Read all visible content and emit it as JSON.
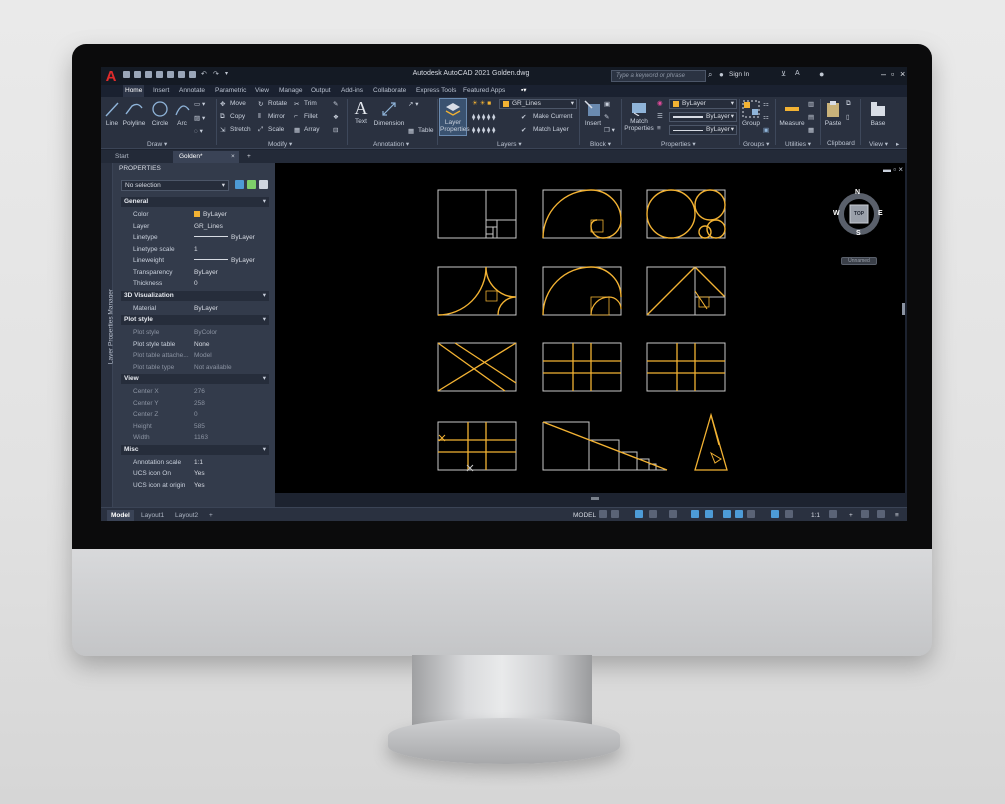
{
  "app": {
    "title": "Autodesk AutoCAD 2021   Golden.dwg",
    "logo": "A",
    "search_placeholder": "Type a keyword or phrase",
    "sign_in": "Sign In",
    "accent_color": "#f2b233"
  },
  "ribbon_tabs": [
    "Home",
    "Insert",
    "Annotate",
    "Parametric",
    "View",
    "Manage",
    "Output",
    "Add-ins",
    "Collaborate",
    "Express Tools",
    "Featured Apps"
  ],
  "ribbon": {
    "draw": {
      "line": "Line",
      "polyline": "Polyline",
      "circle": "Circle",
      "arc": "Arc",
      "panel": "Draw ▾"
    },
    "modify": {
      "move": "Move",
      "rotate": "Rotate",
      "trim": "Trim",
      "copy": "Copy",
      "mirror": "Mirror",
      "fillet": "Fillet",
      "stretch": "Stretch",
      "scale": "Scale",
      "array": "Array",
      "panel": "Modify ▾"
    },
    "annotation": {
      "text": "Text",
      "dimension": "Dimension",
      "table": "Table",
      "panel": "Annotation ▾"
    },
    "layers": {
      "layer_properties_1": "Layer",
      "layer_properties_2": "Properties",
      "layer_name": "GR_Lines",
      "make_current": "Make Current",
      "match_layer": "Match Layer",
      "panel": "Layers ▾"
    },
    "block": {
      "insert": "Insert",
      "panel": "Block ▾"
    },
    "properties": {
      "match_1": "Match",
      "match_2": "Properties",
      "bylayer_color": "ByLayer",
      "bylayer_lineweight": "ByLayer",
      "bylayer_linetype": "ByLayer",
      "panel": "Properties ▾"
    },
    "groups": {
      "group": "Group",
      "panel": "Groups ▾"
    },
    "utilities": {
      "measure": "Measure",
      "panel": "Utilities ▾"
    },
    "clipboard": {
      "paste": "Paste",
      "panel": "Clipboard"
    },
    "view": {
      "base": "Base",
      "panel": "View ▾"
    }
  },
  "file_tabs": [
    "Start",
    "Golden*"
  ],
  "left_palette_label": "Layer Properties Manager",
  "properties": {
    "title": "PROPERTIES",
    "selection": "No selection",
    "sections": [
      {
        "name": "General",
        "rows": [
          {
            "k": "Color",
            "v": "ByLayer",
            "type": "swatch"
          },
          {
            "k": "Layer",
            "v": "GR_Lines"
          },
          {
            "k": "Linetype",
            "v": "ByLayer",
            "type": "line"
          },
          {
            "k": "Linetype scale",
            "v": "1"
          },
          {
            "k": "Lineweight",
            "v": "ByLayer",
            "type": "line"
          },
          {
            "k": "Transparency",
            "v": "ByLayer"
          },
          {
            "k": "Thickness",
            "v": "0"
          }
        ]
      },
      {
        "name": "3D Visualization",
        "rows": [
          {
            "k": "Material",
            "v": "ByLayer"
          }
        ]
      },
      {
        "name": "Plot style",
        "rows": [
          {
            "k": "Plot style",
            "v": "ByColor",
            "dim": true
          },
          {
            "k": "Plot style table",
            "v": "None"
          },
          {
            "k": "Plot table attache...",
            "v": "Model",
            "dim": true
          },
          {
            "k": "Plot table type",
            "v": "Not available",
            "dim": true
          }
        ]
      },
      {
        "name": "View",
        "rows": [
          {
            "k": "Center X",
            "v": "276",
            "dim": true
          },
          {
            "k": "Center Y",
            "v": "258",
            "dim": true
          },
          {
            "k": "Center Z",
            "v": "0",
            "dim": true
          },
          {
            "k": "Height",
            "v": "585",
            "dim": true
          },
          {
            "k": "Width",
            "v": "1163",
            "dim": true
          }
        ]
      },
      {
        "name": "Misc",
        "rows": [
          {
            "k": "Annotation scale",
            "v": "1:1"
          },
          {
            "k": "UCS icon On",
            "v": "Yes"
          },
          {
            "k": "UCS icon at origin",
            "v": "Yes"
          }
        ]
      }
    ]
  },
  "viewcube": {
    "n": "N",
    "s": "S",
    "e": "E",
    "w": "W",
    "top": "TOP",
    "unnamed": "Unnamed"
  },
  "layout_tabs": [
    "Model",
    "Layout1",
    "Layout2"
  ],
  "status": {
    "model": "MODEL",
    "scale": "1:1"
  }
}
